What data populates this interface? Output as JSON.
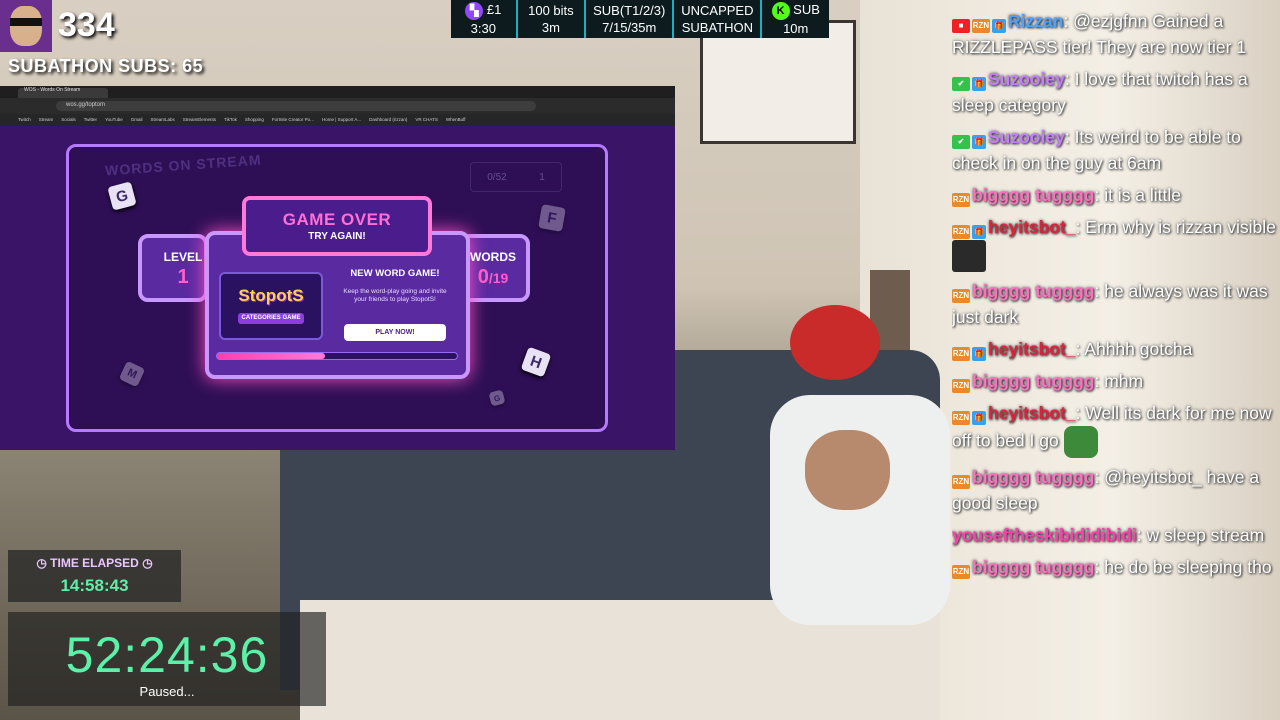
{
  "sub_counter": {
    "count": "334",
    "label": "SUBATHON SUBS: 65"
  },
  "ticker": [
    {
      "icon": "twitch-icon",
      "line1": "£1",
      "line2": "3:30"
    },
    {
      "line1": "100 bits",
      "line2": "3m"
    },
    {
      "line1": "SUB(T1/2/3)",
      "line2": "7/15/35m"
    },
    {
      "line1": "UNCAPPED",
      "line2": "SUBATHON"
    },
    {
      "icon": "kick-icon",
      "line1": "SUB",
      "line2": "10m"
    }
  ],
  "browser": {
    "tab_title": "WOS - Words On Stream",
    "url": "wos.gg/toptom",
    "bookmarks": [
      "Twitch",
      "Stream",
      "Socials",
      "Twitter",
      "YouTube",
      "Gmail",
      "StreamLabs",
      "StreamElements",
      "TikTok",
      "Shopping",
      "Fortnite Creator Po...",
      "Home | Support A...",
      "Dashboard (rizzan)",
      "VR CHATS",
      "WhenBuff"
    ]
  },
  "game": {
    "logo": "WORDS ON STREAM",
    "stats": [
      "0/52",
      "1"
    ],
    "title": "GAME OVER",
    "subtitle": "TRY AGAIN!",
    "level_label": "LEVEL",
    "level_value": "1",
    "words_label": "WORDS",
    "words_value": "0",
    "words_total": "/19",
    "promo_logo": "StopotS",
    "promo_tag": "CATEGORIES GAME",
    "promo_title": "NEW WORD GAME!",
    "promo_text": "Keep the word-play going and invite your friends to play StopotS!",
    "play_button": "PLAY NOW!",
    "progress": 0.45,
    "dice": [
      "G",
      "F",
      "H",
      "M",
      "G"
    ]
  },
  "elapsed": {
    "label": "TIME ELAPSED",
    "value": "14:58:43"
  },
  "timer": {
    "value": "52:24:36",
    "status": "Paused..."
  },
  "chat": [
    {
      "badges": [
        "cam",
        "rzn",
        "gift"
      ],
      "user": "Rizzan",
      "color": "#4aa3ff",
      "text": "@ezjgfnn Gained a RIZZLEPASS tier! They are now tier 1"
    },
    {
      "badges": [
        "check",
        "gift"
      ],
      "user": "Suzooiey",
      "color": "#c77dff",
      "text": "I love that twitch has a sleep category"
    },
    {
      "badges": [
        "check",
        "gift"
      ],
      "user": "Suzooiey",
      "color": "#c77dff",
      "text": "Its weird to be able to check in on the guy at 6am"
    },
    {
      "badges": [
        "rzn"
      ],
      "user": "bigggg tugggg",
      "color": "#ff6fc2",
      "text": "it is a little"
    },
    {
      "badges": [
        "rzn",
        "gift"
      ],
      "user": "heyitsbot_",
      "color": "#e0213a",
      "text": "Erm why is rizzan visible",
      "emote": "emote-icon"
    },
    {
      "badges": [
        "rzn"
      ],
      "user": "bigggg tugggg",
      "color": "#ff6fc2",
      "text": "he always was it was just dark"
    },
    {
      "badges": [
        "rzn",
        "gift"
      ],
      "user": "heyitsbot_",
      "color": "#e0213a",
      "text": "Ahhhh gotcha"
    },
    {
      "badges": [
        "rzn"
      ],
      "user": "bigggg tugggg",
      "color": "#ff6fc2",
      "text": "mhm"
    },
    {
      "badges": [
        "rzn",
        "gift"
      ],
      "user": "heyitsbot_",
      "color": "#e0213a",
      "text": "Well its dark for me now off to bed I go",
      "emote": "frog-emote-icon"
    },
    {
      "badges": [
        "rzn"
      ],
      "user": "bigggg tugggg",
      "color": "#ff6fc2",
      "text": "@heyitsbot_ have a good sleep"
    },
    {
      "badges": [],
      "user": "youseftheskibididibidi",
      "color": "#ff3fae",
      "text": "w sleep stream"
    },
    {
      "badges": [
        "rzn"
      ],
      "user": "bigggg tugggg",
      "color": "#ff6fc2",
      "text": "he do be sleeping tho"
    }
  ]
}
